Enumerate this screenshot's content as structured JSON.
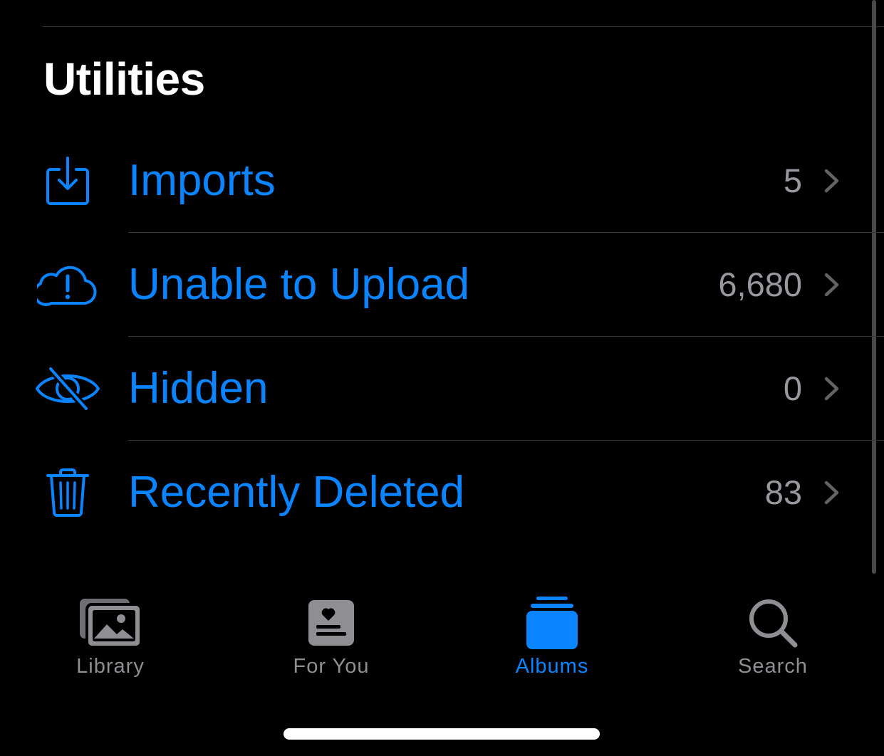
{
  "section": {
    "title": "Utilities"
  },
  "rows": [
    {
      "icon": "import-tray-icon",
      "label": "Imports",
      "count": "5"
    },
    {
      "icon": "cloud-exclamation-icon",
      "label": "Unable to Upload",
      "count": "6,680"
    },
    {
      "icon": "eye-slash-icon",
      "label": "Hidden",
      "count": "0"
    },
    {
      "icon": "trash-icon",
      "label": "Recently Deleted",
      "count": "83"
    }
  ],
  "tab_bar": {
    "tabs": [
      {
        "icon": "photos-stack-icon",
        "label": "Library",
        "active": false
      },
      {
        "icon": "for-you-card-icon",
        "label": "For You",
        "active": false
      },
      {
        "icon": "albums-stack-icon",
        "label": "Albums",
        "active": true
      },
      {
        "icon": "magnifying-glass-icon",
        "label": "Search",
        "active": false
      }
    ]
  },
  "colors": {
    "background": "#000000",
    "accent": "#0a84ff",
    "secondary_text": "#98989f",
    "inactive_tab": "#8e8e93",
    "separator": "#38383a"
  }
}
